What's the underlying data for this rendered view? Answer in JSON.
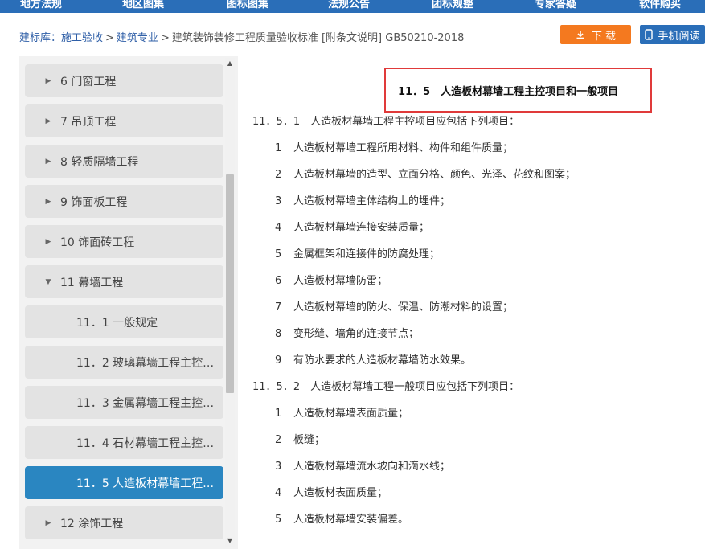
{
  "topnav": [
    "地方法规",
    "地区图集",
    "图标图集",
    "法规公告",
    "团标规整",
    "专家答疑",
    "软件购买"
  ],
  "breadcrumb": {
    "items": [
      "建标库：施工验收",
      "建筑专业",
      "建筑装饰装修工程质量验收标准 [附条文说明] GB50210-2018"
    ],
    "separator": ">"
  },
  "buttons": {
    "download": "下 载",
    "mobile": "手机阅读"
  },
  "sidebar": {
    "items": [
      {
        "label": "6 门窗工程",
        "arrow": "▶"
      },
      {
        "label": "7 吊顶工程",
        "arrow": "▶"
      },
      {
        "label": "8 轻质隔墙工程",
        "arrow": "▶"
      },
      {
        "label": "9 饰面板工程",
        "arrow": "▶"
      },
      {
        "label": "10 饰面砖工程",
        "arrow": "▶"
      },
      {
        "label": "11 幕墙工程",
        "arrow": "▼"
      },
      {
        "label": "11．1 一般规定"
      },
      {
        "label": "11．2 玻璃幕墙工程主控项..."
      },
      {
        "label": "11．3 金属幕墙工程主控项..."
      },
      {
        "label": "11．4 石材幕墙工程主控项..."
      },
      {
        "label": "11．5 人造板材幕墙工程主..."
      },
      {
        "label": "12 涂饰工程",
        "arrow": "▶"
      }
    ]
  },
  "content": {
    "title": "11．5　人造板材幕墙工程主控项目和一般项目",
    "lines": [
      {
        "num": "",
        "text": "11．5．1　人造板材幕墙工程主控项目应包括下列项目："
      },
      {
        "num": "1",
        "text": "人造板材幕墙工程所用材料、构件和组件质量；"
      },
      {
        "num": "2",
        "text": "人造板材幕墙的造型、立面分格、颜色、光泽、花纹和图案；"
      },
      {
        "num": "3",
        "text": "人造板材幕墙主体结构上的埋件；"
      },
      {
        "num": "4",
        "text": "人造板材幕墙连接安装质量；"
      },
      {
        "num": "5",
        "text": "金属框架和连接件的防腐处理；"
      },
      {
        "num": "6",
        "text": "人造板材幕墙防雷；"
      },
      {
        "num": "7",
        "text": "人造板材幕墙的防火、保温、防潮材料的设置；"
      },
      {
        "num": "8",
        "text": "变形缝、墙角的连接节点；"
      },
      {
        "num": "9",
        "text": "有防水要求的人造板材幕墙防水效果。"
      },
      {
        "num": "",
        "text": "11．5．2　人造板材幕墙工程一般项目应包括下列项目："
      },
      {
        "num": "1",
        "text": "人造板材幕墙表面质量；"
      },
      {
        "num": "2",
        "text": "板缝；"
      },
      {
        "num": "3",
        "text": "人造板材幕墙流水坡向和滴水线；"
      },
      {
        "num": "4",
        "text": "人造板材表面质量；"
      },
      {
        "num": "5",
        "text": "人造板材幕墙安装偏差。"
      }
    ]
  },
  "colors": {
    "primary": "#2a6eb8",
    "download": "#f4791f",
    "active_item": "#2a86c1",
    "highlight_border": "#e03a3a"
  },
  "icons": {
    "download": "download-icon",
    "mobile": "mobile-phone-icon"
  }
}
